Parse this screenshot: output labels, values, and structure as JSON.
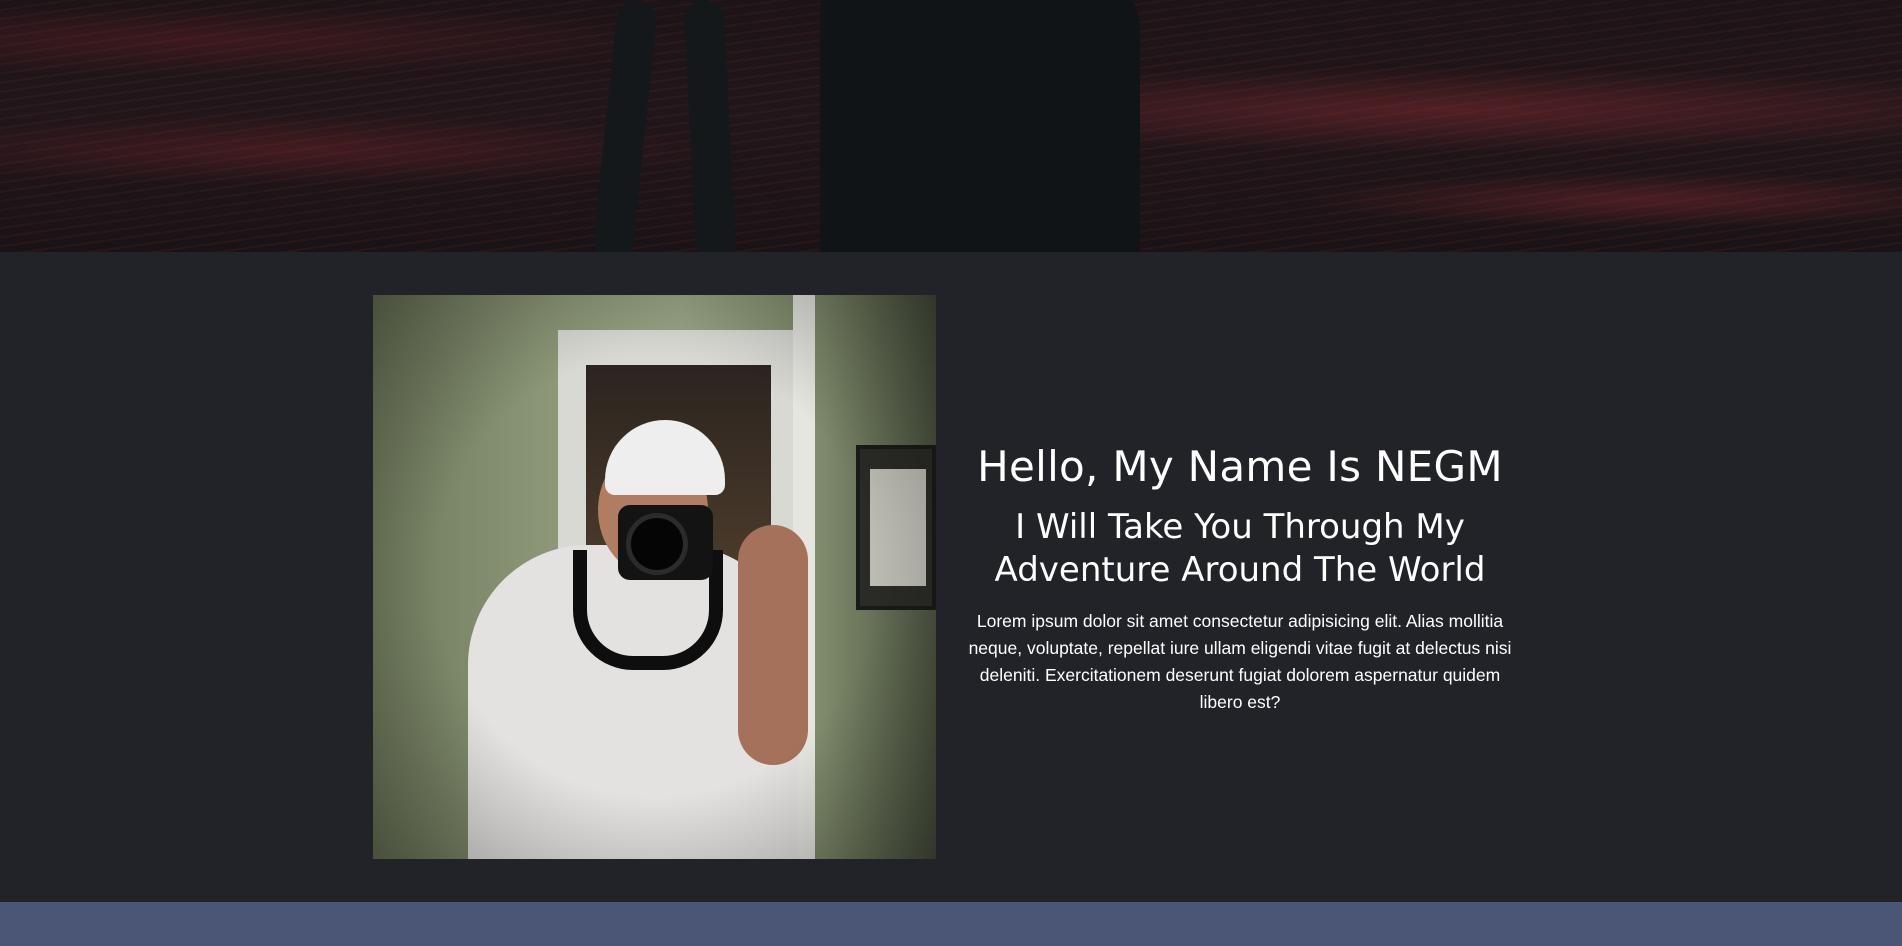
{
  "hero": {
    "image": "photographer-silhouette-sea-photo"
  },
  "about": {
    "image": "man-with-camera-mirror-selfie-photo",
    "title": "Hello, My Name Is NEGM",
    "subtitle": "I Will Take You Through My Adventure Around The World",
    "description": "Lorem ipsum dolor sit amet consectetur adipisicing elit. Alias mollitia neque, voluptate, repellat iure ullam eligendi vitae fugit at delectus nisi deleniti. Exercitationem deserunt fugiat dolorem aspernatur quidem libero est?"
  },
  "colors": {
    "page_background": "#212329",
    "next_section_background": "#4b5575",
    "text": "#ffffff"
  }
}
